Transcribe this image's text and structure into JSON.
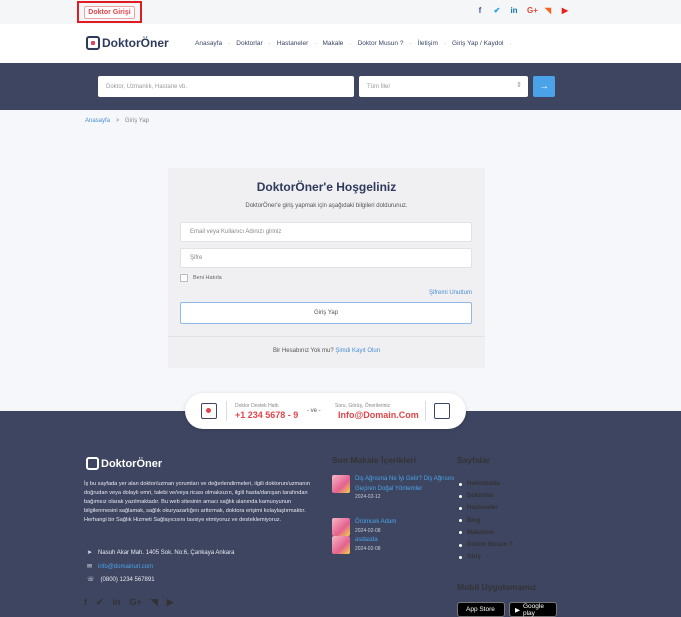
{
  "topbar": {
    "login_label": "Doktor Girişi",
    "social_icons": [
      {
        "name": "facebook-icon",
        "glyph": "f",
        "color": "#3b5998"
      },
      {
        "name": "twitter-icon",
        "glyph": "🐦",
        "color": "#1da1f2"
      },
      {
        "name": "linkedin-icon",
        "glyph": "in",
        "color": "#0e76a8"
      },
      {
        "name": "google-plus-icon",
        "glyph": "G+",
        "color": "#dd4b39"
      },
      {
        "name": "rss-icon",
        "glyph": "◥",
        "color": "#f26522"
      },
      {
        "name": "youtube-icon",
        "glyph": "▶",
        "color": "#e62117"
      }
    ]
  },
  "header": {
    "logo_text": "DoktorÖner",
    "nav": [
      "Anasayfa",
      "Doktorlar",
      "Hastaneler",
      "Makale",
      "Doktor Musun ?",
      "İletişim",
      "Giriş Yap / Kaydol"
    ]
  },
  "search": {
    "placeholder": "Doktor, Uzmanlık, Hastane vb.",
    "city_selected": "Tüm İller",
    "button_icon": "arrow-right-icon"
  },
  "breadcrumb": {
    "home": "Anasayfa",
    "separator": ">",
    "current": "Giriş Yap"
  },
  "login": {
    "title": "DoktorÖner'e Hoşgeliniz",
    "subtitle": "DoktorÖner'e giriş yapmak için aşağıdaki bilgileri doldurunuz.",
    "email_placeholder": "Email veya Kullanıcı Adınızı giriniz",
    "password_placeholder": "Şifre",
    "remember_label": "Beni Hatırla",
    "forgot_link": "Şifremi Unuttum",
    "submit_label": "Giriş Yap",
    "register_prompt": "Bir Hesabınız Yok mu?",
    "register_link": "Şimdi Kayıt Olun"
  },
  "support": {
    "hotline_label": "Doktor Destek Hattı",
    "hotline_number": "+1 234 5678 - 9",
    "joiner": "- ve -",
    "feedback_label": "Soru, Görüş, Önerileriniz",
    "feedback_email": "Info@Domain.Com"
  },
  "footer": {
    "logo_text": "DoktorÖner",
    "about": "İş bu sayfada yer alan doktor/uzman yorumları ve değerlendirmeleri, ilgili doktorun/uzmanın doğrudan veya dolaylı emri, talebi ve/veya ricası olmaksızın, ilgili hasta/danışan tarafından bağımsız olarak yazılmaktadır. Bu web sitesinin amacı sağlık alanında kamuoyunun bilgilenmesini sağlamak, sağlık okuryazarlığını arttırmak, doktora erişimi kolaylaştırmaktır. Herhangi bir Sağlık Hizmeti Sağlayıcısını tavsiye etmiyoruz ve desteklemiyoruz.",
    "address": "Nasuh Akar Mah. 1405 Sok. No:6, Çankaya Ankara",
    "email": "info@domainurl.com",
    "phone": "(0800) 1234 567891",
    "articles_title": "Son Makale İçerikleri",
    "articles": [
      {
        "title": "Diş Ağrısına Ne İyi Gelir? Diş Ağrısını Geçiren Doğal Yöntemler",
        "date": "2024-02-12"
      },
      {
        "title": "Örümcek Adam",
        "date": "2024-02-08"
      },
      {
        "title": "asdasda",
        "date": "2024-02-08"
      }
    ],
    "pages_title": "Sayfalar",
    "pages": [
      "Hakkımızda",
      "Doktorlar",
      "Hastaneler",
      "Blog",
      "Makaleler",
      "Doktor Musun ?",
      "Giriş"
    ],
    "mobile_title": "Mobil Uygulamamız",
    "app_store": "App Store",
    "google_play": "Google play",
    "social_icons": [
      "facebook-icon",
      "twitter-icon",
      "linkedin-icon",
      "google-plus-icon",
      "rss-icon",
      "youtube-icon"
    ]
  },
  "colors": {
    "brand_dark": "#3e4561",
    "accent_red": "#e0454a",
    "accent_blue": "#4aa3e8"
  }
}
